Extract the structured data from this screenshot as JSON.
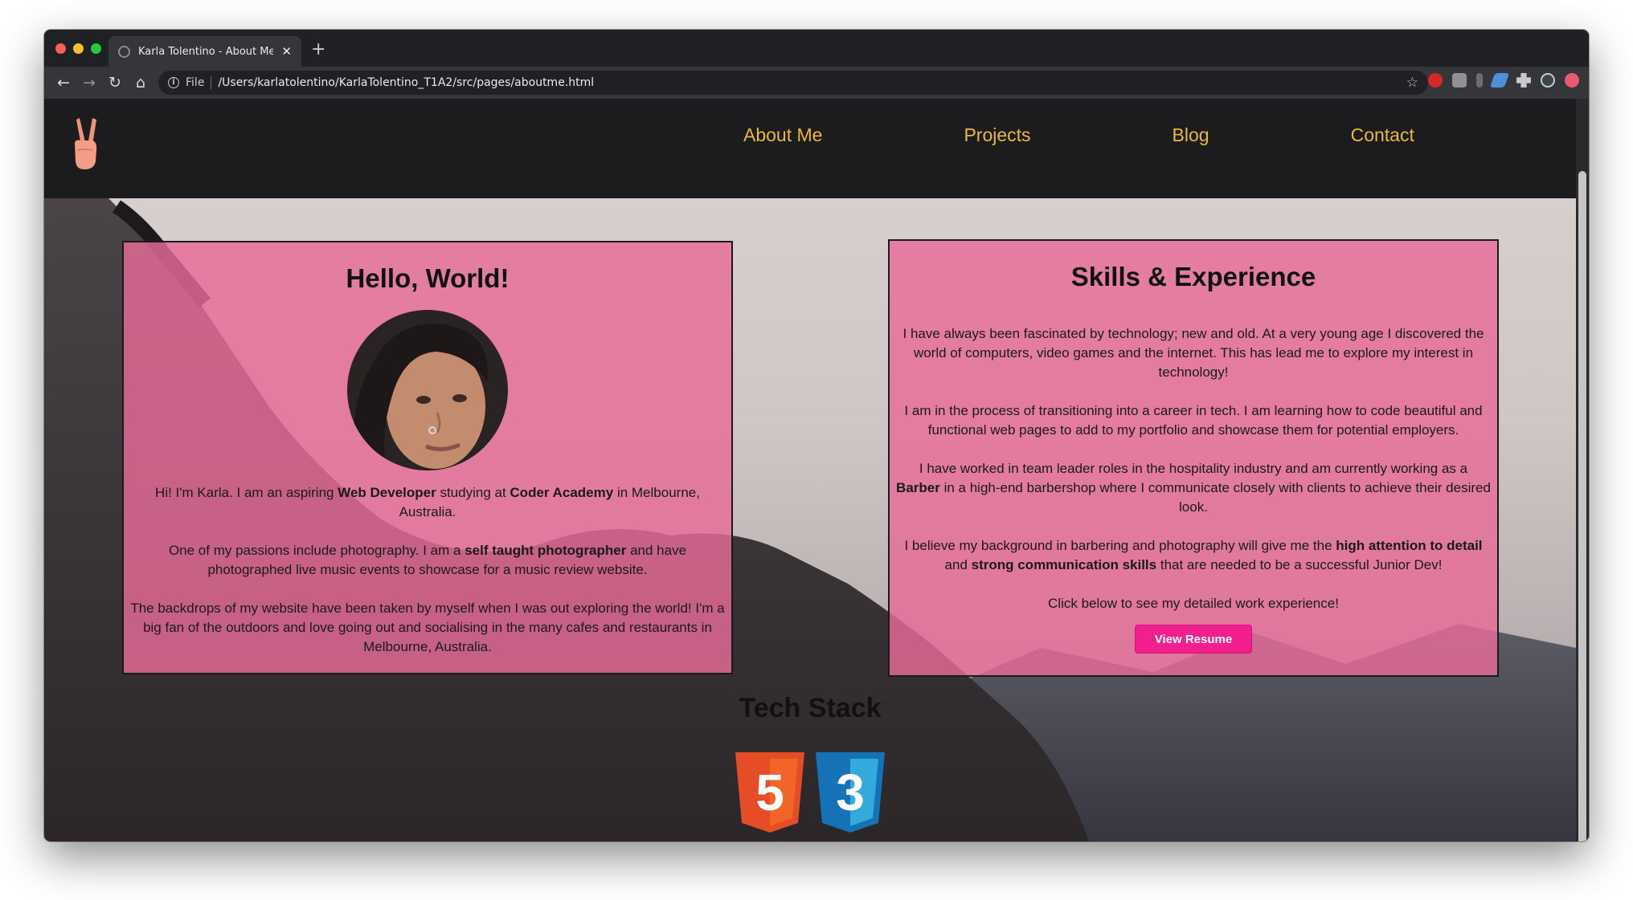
{
  "browser": {
    "tab_title": "Karla Tolentino - About Me",
    "new_tab": "+",
    "scheme": "File",
    "url": "/Users/karlatolentino/KarlaTolentino_T1A2/src/pages/aboutme.html"
  },
  "site": {
    "nav": [
      "About Me",
      "Projects",
      "Blog",
      "Contact"
    ]
  },
  "hello_card": {
    "title": "Hello, World!",
    "p1_parts": [
      "Hi! I'm Karla. I am an aspiring ",
      "Web Developer",
      " studying at ",
      "Coder Academy",
      " in Melbourne, Australia."
    ],
    "p2_parts": [
      "One of my passions include photography. I am a ",
      "self taught photographer",
      " and have photographed live music events to showcase for a music review website."
    ],
    "p3": "The backdrops of my website have been taken by myself when I was out exploring the world! I'm a big fan of the outdoors and love going out and socialising in the many cafes and restaurants in Melbourne, Australia."
  },
  "skills_card": {
    "title": "Skills & Experience",
    "p1": "I have always been fascinated by technology; new and old. At a very young age I discovered the world of computers, video games and the internet. This has lead me to explore my interest in technology!",
    "p2": "I am in the process of transitioning into a career in tech. I am learning how to code beautiful and functional web pages to add to my portfolio and showcase them for potential employers.",
    "p3_parts": [
      "I have worked in team leader roles in the hospitality industry and am currently working as a ",
      "Barber",
      " in a high-end barbershop where I communicate closely with clients to achieve their desired look."
    ],
    "p4_parts": [
      "I believe my background in barbering and photography will give me the ",
      "high attention to detail",
      " and ",
      "strong communication skills",
      " that are needed to be a successful Junior Dev!"
    ],
    "p5": "Click below to see my detailed work experience!",
    "button": "View Resume"
  },
  "tech_stack": {
    "title": "Tech Stack",
    "items": [
      {
        "label": "HTML",
        "badge": "5",
        "color": "#e44d26"
      },
      {
        "label": "CSS",
        "badge": "3",
        "color": "#1572b6"
      }
    ]
  },
  "colors": {
    "nav_text": "#eab935",
    "card_bg": "#e86b98",
    "button": "#f31f8f"
  }
}
